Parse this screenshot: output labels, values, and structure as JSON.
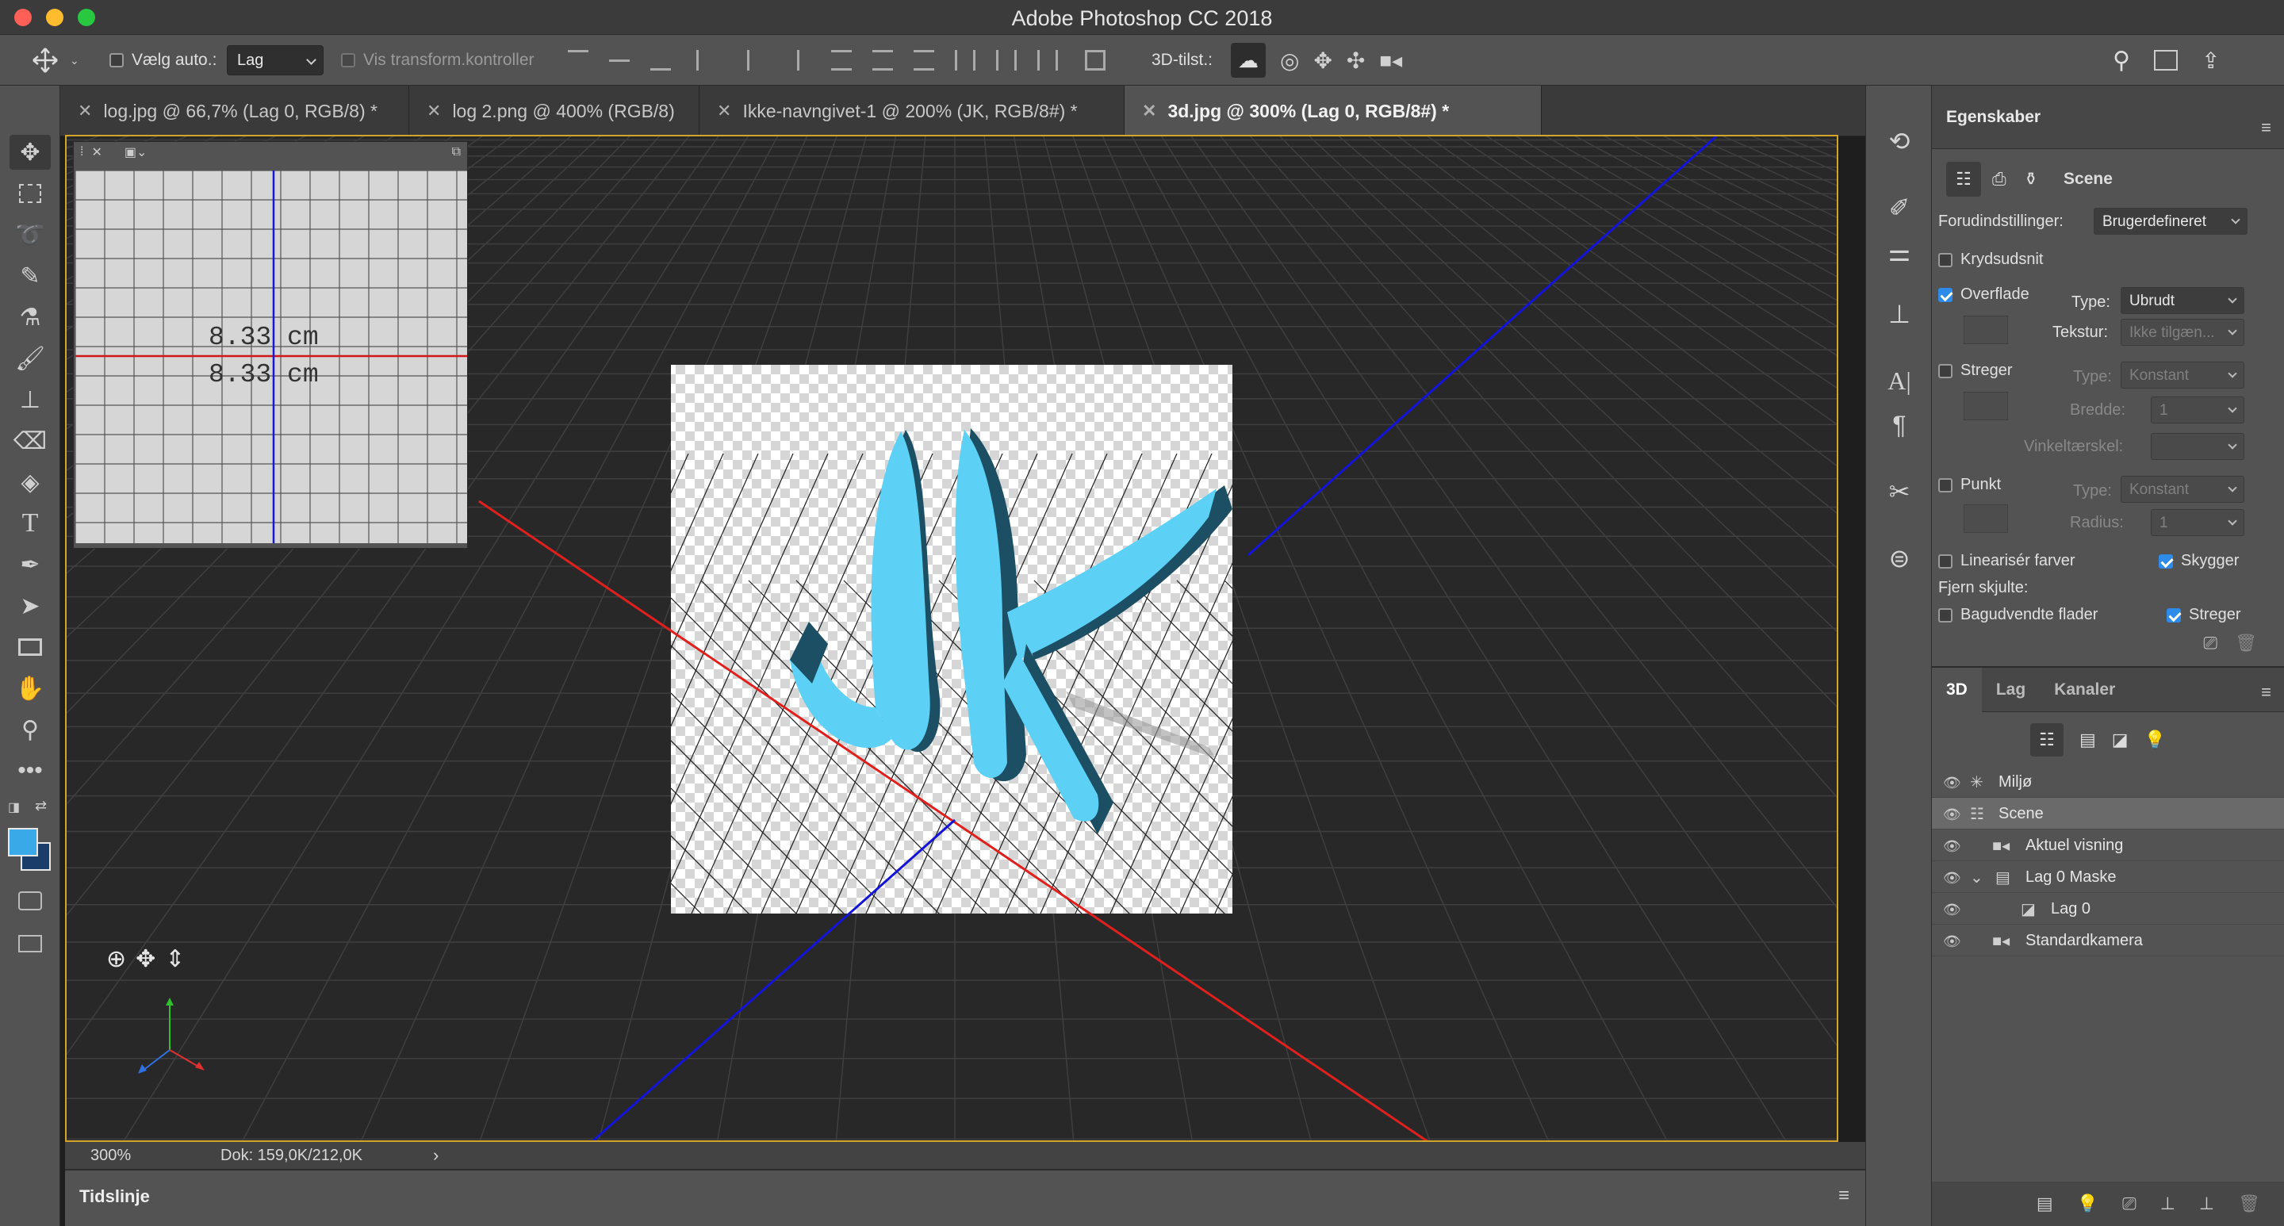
{
  "app": {
    "title": "Adobe Photoshop CC 2018"
  },
  "options_bar": {
    "auto_select_label": "Vælg auto.:",
    "auto_select_value": "Lag",
    "show_transform_label": "Vis transform.kontroller",
    "mode_3d_label": "3D-tilst.:"
  },
  "tabs": [
    {
      "label": "log.jpg @ 66,7% (Lag 0, RGB/8) *",
      "active": false
    },
    {
      "label": "log 2.png @ 400% (RGB/8)",
      "active": false
    },
    {
      "label": "Ikke-navngivet-1 @ 200% (JK, RGB/8#) *",
      "active": false
    },
    {
      "label": "3d.jpg @ 300% (Lag 0, RGB/8#) *",
      "active": true
    }
  ],
  "tools": [
    "move-tool-icon",
    "marquee-tool-icon",
    "lasso-tool-icon",
    "quick-select-tool-icon",
    "eyedropper-tool-icon",
    "brush-tool-icon",
    "stamp-tool-icon",
    "eraser-tool-icon",
    "paint-bucket-tool-icon",
    "type-tool-icon",
    "pen-tool-icon",
    "path-select-tool-icon",
    "rectangle-tool-icon",
    "hand-tool-icon",
    "zoom-tool-icon",
    "more-tools-icon"
  ],
  "colors": {
    "foreground": "#3aa9e8",
    "background": "#1a3d6a",
    "accent": "#2d8ceb",
    "canvas_border": "#d2a52a",
    "letter_fill": "#5cd0f5",
    "letter_side": "#1c4f63"
  },
  "viewer": {
    "measure_1": "8.33 cm",
    "measure_2": "8.33 cm"
  },
  "artwork": {
    "text": "JK"
  },
  "status": {
    "zoom": "300%",
    "doc": "Dok: 159,0K/212,0K"
  },
  "timeline": {
    "label": "Tidslinje"
  },
  "properties": {
    "title": "Egenskaber",
    "scene_label": "Scene",
    "preset_label": "Forudindstillinger:",
    "preset_value": "Brugerdefineret",
    "cross_section": "Krydsudsnit",
    "surface": {
      "label": "Overflade",
      "type_label": "Type:",
      "type_value": "Ubrudt",
      "texture_label": "Tekstur:",
      "texture_value": "Ikke tilgæn..."
    },
    "lines": {
      "label": "Streger",
      "type_label": "Type:",
      "type_value": "Konstant",
      "width_label": "Bredde:",
      "width_value": "1",
      "angle_label": "Vinkeltærskel:"
    },
    "point": {
      "label": "Punkt",
      "type_label": "Type:",
      "type_value": "Konstant",
      "radius_label": "Radius:",
      "radius_value": "1"
    },
    "linearize": "Linearisér farver",
    "shadows": "Skygger",
    "remove_hidden": "Fjern skjulte:",
    "backfaces": "Bagudvendte flader",
    "lines2": "Streger"
  },
  "panel3d": {
    "tabs": [
      "3D",
      "Lag",
      "Kanaler"
    ],
    "items": [
      {
        "name": "Miljø",
        "icon": "environment-icon",
        "eye": true
      },
      {
        "name": "Scene",
        "icon": "scene-icon",
        "eye": true,
        "selected": true
      },
      {
        "name": "Aktuel visning",
        "icon": "camera-icon",
        "eye": true
      },
      {
        "name": "Lag 0 Maske",
        "icon": "mesh-icon",
        "eye": true
      },
      {
        "name": "Lag 0",
        "icon": "material-icon",
        "eye": true
      },
      {
        "name": "Standardkamera",
        "icon": "camera-icon",
        "eye": true
      }
    ]
  }
}
